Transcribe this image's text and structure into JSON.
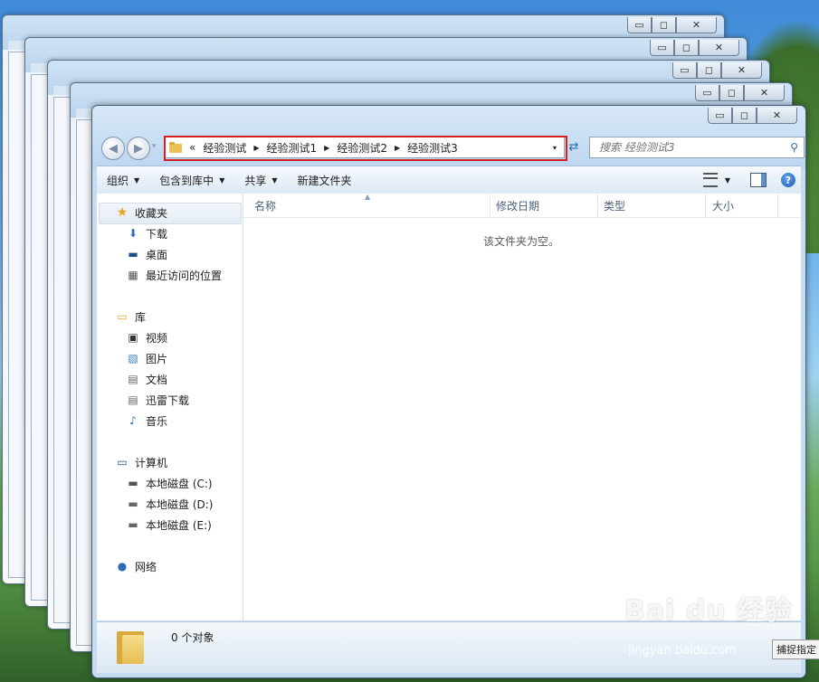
{
  "title_controls": {
    "minimize": "▭",
    "maximize": "◻",
    "close": "✕"
  },
  "nav": {
    "back": "◀",
    "forward": "▶",
    "history_dropdown": "▾"
  },
  "address": {
    "overflow": "«",
    "crumbs": [
      "经验测试",
      "经验测试1",
      "经验测试2",
      "经验测试3"
    ],
    "dropdown": "▾",
    "highlight_color": "#d61f1f"
  },
  "search": {
    "placeholder": "搜索 经验测试3"
  },
  "toolbar": {
    "organize": "组织",
    "include_in_library": "包含到库中",
    "share": "共享",
    "new_folder": "新建文件夹"
  },
  "sidebar": {
    "favorites": {
      "label": "收藏夹",
      "items": [
        "下载",
        "桌面",
        "最近访问的位置"
      ]
    },
    "libraries": {
      "label": "库",
      "items": [
        "视频",
        "图片",
        "文档",
        "迅雷下载",
        "音乐"
      ]
    },
    "computer": {
      "label": "计算机",
      "items": [
        "本地磁盘 (C:)",
        "本地磁盘 (D:)",
        "本地磁盘 (E:)"
      ]
    },
    "network": {
      "label": "网络"
    }
  },
  "columns": [
    "名称",
    "修改日期",
    "类型",
    "大小"
  ],
  "empty_message": "该文件夹为空。",
  "status": {
    "count": "0 个对象"
  },
  "watermark": {
    "brand": "Bai du 经验",
    "url": "jingyan.baidu.com"
  },
  "capture_tooltip": "捕捉指定"
}
